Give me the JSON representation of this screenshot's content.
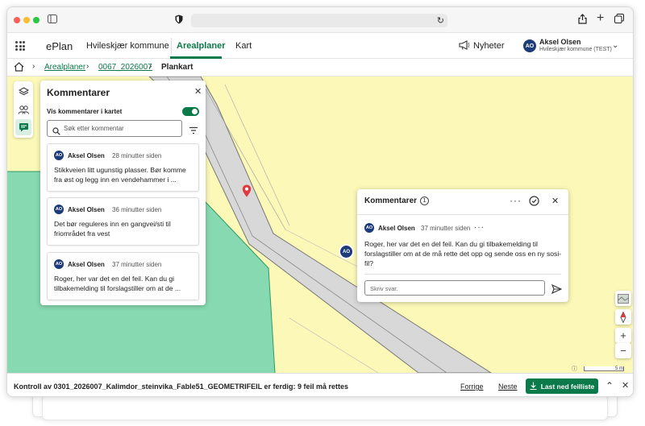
{
  "app": {
    "brand": "ePlan",
    "nav": [
      "Hvileskjær kommune",
      "Arealplaner",
      "Kart"
    ],
    "active_nav": "Arealplaner",
    "news": "Nyheter",
    "user": {
      "initials": "AO",
      "name": "Aksel Olsen",
      "org": "Hvileskjær kommune (TEST)"
    }
  },
  "breadcrumb": {
    "items": [
      "Arealplaner",
      "0067_2026007"
    ],
    "current": "Plankart"
  },
  "comments_panel": {
    "title": "Kommentarer",
    "toggle_label": "Vis kommentarer i kartet",
    "toggle_on": true,
    "search_placeholder": "Søk etter kommentar",
    "items": [
      {
        "initials": "AO",
        "author": "Aksel Olsen",
        "time": "28 minutter siden",
        "text": "Stikkveien litt ugunstig plasser. Bør komme fra øst og legg inn en vendehammer i ..."
      },
      {
        "initials": "AO",
        "author": "Aksel Olsen",
        "time": "36 minutter siden",
        "text": "Det bør reguleres inn en gangvei/sti til friområdet fra vest"
      },
      {
        "initials": "AO",
        "author": "Aksel Olsen",
        "time": "37 minutter siden",
        "text": "Roger, her var det en del feil. Kan du gi tilbakemelding til forslagstiller om at de ..."
      }
    ]
  },
  "popup": {
    "title": "Kommentarer",
    "count": "1",
    "initials": "AO",
    "author": "Aksel Olsen",
    "time": "37 minutter siden",
    "text": "Roger, her var det en del feil. Kan du gi tilbakemelding til forslagstiller om at de må rette det opp og sende oss en ny sosi-fil?",
    "reply_placeholder": "Skriv svar."
  },
  "map": {
    "marker_initials": "AO",
    "scale_label": "5 m"
  },
  "bottom": {
    "message": "Kontroll av 0301_2026007_Kalimdor_steinvika_Fable51_GEOMETRIFEIL er ferdig: 9 feil må rettes",
    "prev": "Forrige",
    "next": "Neste",
    "download": "Last ned feilliste"
  },
  "colors": {
    "accent": "#0b7a4a",
    "map_yellow": "#fbf8b8",
    "map_green": "#86d9b0",
    "avatar": "#1d3a7a",
    "pin": "#e0393e"
  },
  "icons": [
    "sidebar-icon",
    "shield-icon",
    "reload-icon",
    "share-icon",
    "plus-icon",
    "tabs-icon",
    "apps-grid-icon",
    "megaphone-icon",
    "chevron-down-icon",
    "home-icon",
    "chevron-right-icon",
    "layers-icon",
    "users-icon",
    "comment-icon",
    "close-icon",
    "search-icon",
    "filter-icon",
    "more-icon",
    "check-circle-icon",
    "send-icon",
    "map-pin-icon",
    "basemap-icon",
    "compass-icon",
    "zoom-in-icon",
    "zoom-out-icon",
    "info-icon",
    "download-icon",
    "chevron-up-icon"
  ]
}
